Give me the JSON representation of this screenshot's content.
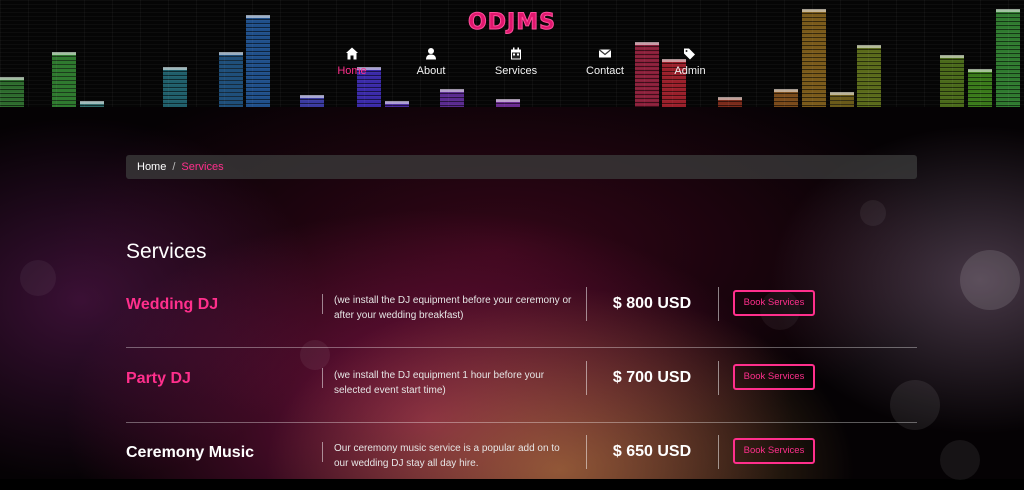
{
  "header": {
    "logo_text": "ODJMS",
    "nav": [
      {
        "label": "Home",
        "icon": "home-icon",
        "active": true
      },
      {
        "label": "About",
        "icon": "user-icon",
        "active": false
      },
      {
        "label": "Services",
        "icon": "calendar-icon",
        "active": false
      },
      {
        "label": "Contact",
        "icon": "envelope-icon",
        "active": false
      },
      {
        "label": "Admin",
        "icon": "tags-icon",
        "active": false
      }
    ]
  },
  "breadcrumb": {
    "home": "Home",
    "separator": "/",
    "current": "Services"
  },
  "main": {
    "title": "Services",
    "services": [
      {
        "name": "Wedding DJ",
        "name_color": "#ff2f8c",
        "description": "(we install the DJ equipment before your ceremony or after your wedding breakfast)",
        "price": "$ 800 USD",
        "button": "Book Services"
      },
      {
        "name": "Party DJ",
        "name_color": "#ff2f8c",
        "description": "(we install the DJ equipment 1 hour before your selected event start time)",
        "price": "$ 700 USD",
        "button": "Book Services"
      },
      {
        "name": "Ceremony Music",
        "name_color": "#ffffff",
        "description": "Our ceremony music service is a popular add on to our wedding DJ stay all day hire.",
        "price": "$ 650 USD",
        "button": "Book Services"
      }
    ]
  },
  "colors": {
    "accent": "#ff2f8c",
    "logo": "#e0176e"
  }
}
